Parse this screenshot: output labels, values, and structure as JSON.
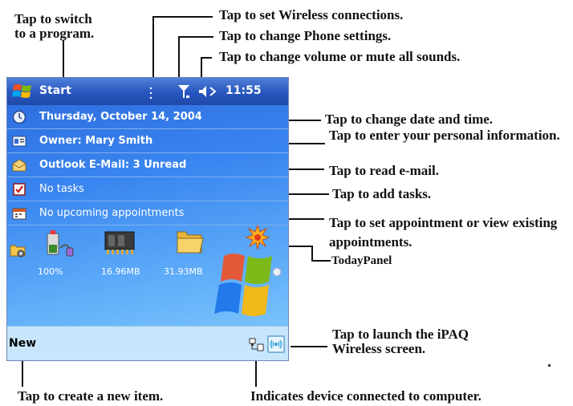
{
  "callouts": {
    "switch_program": "Tap to switch\nto a program.",
    "wireless": "Tap to set Wireless connections.",
    "phone": "Tap to change Phone settings.",
    "volume": "Tap to change volume or mute all sounds.",
    "date_time": "Tap to change date and time.",
    "personal_info": "Tap to enter your personal information.",
    "email": "Tap to read e-mail.",
    "tasks": "Tap to add tasks.",
    "appointments": "Tap to set appointment or view existing appointments.",
    "today_panel": "TodayPanel",
    "ipaq_wireless": "Tap to launch the iPAQ Wireless screen.",
    "new_item": "Tap to create a new item.",
    "connected": "Indicates device connected to computer."
  },
  "titlebar": {
    "start_label": "Start",
    "time": "11:55"
  },
  "today": {
    "date": "Thursday, October 14, 2004",
    "owner": "Owner: Mary Smith",
    "email": "Outlook E-Mail: 3 Unread",
    "tasks": "No tasks",
    "appointments": "No upcoming appointments",
    "battery": "100%",
    "main_memory": "16.96MB",
    "storage_memory": "31.93MB"
  },
  "command_bar": {
    "new_label": "New"
  }
}
